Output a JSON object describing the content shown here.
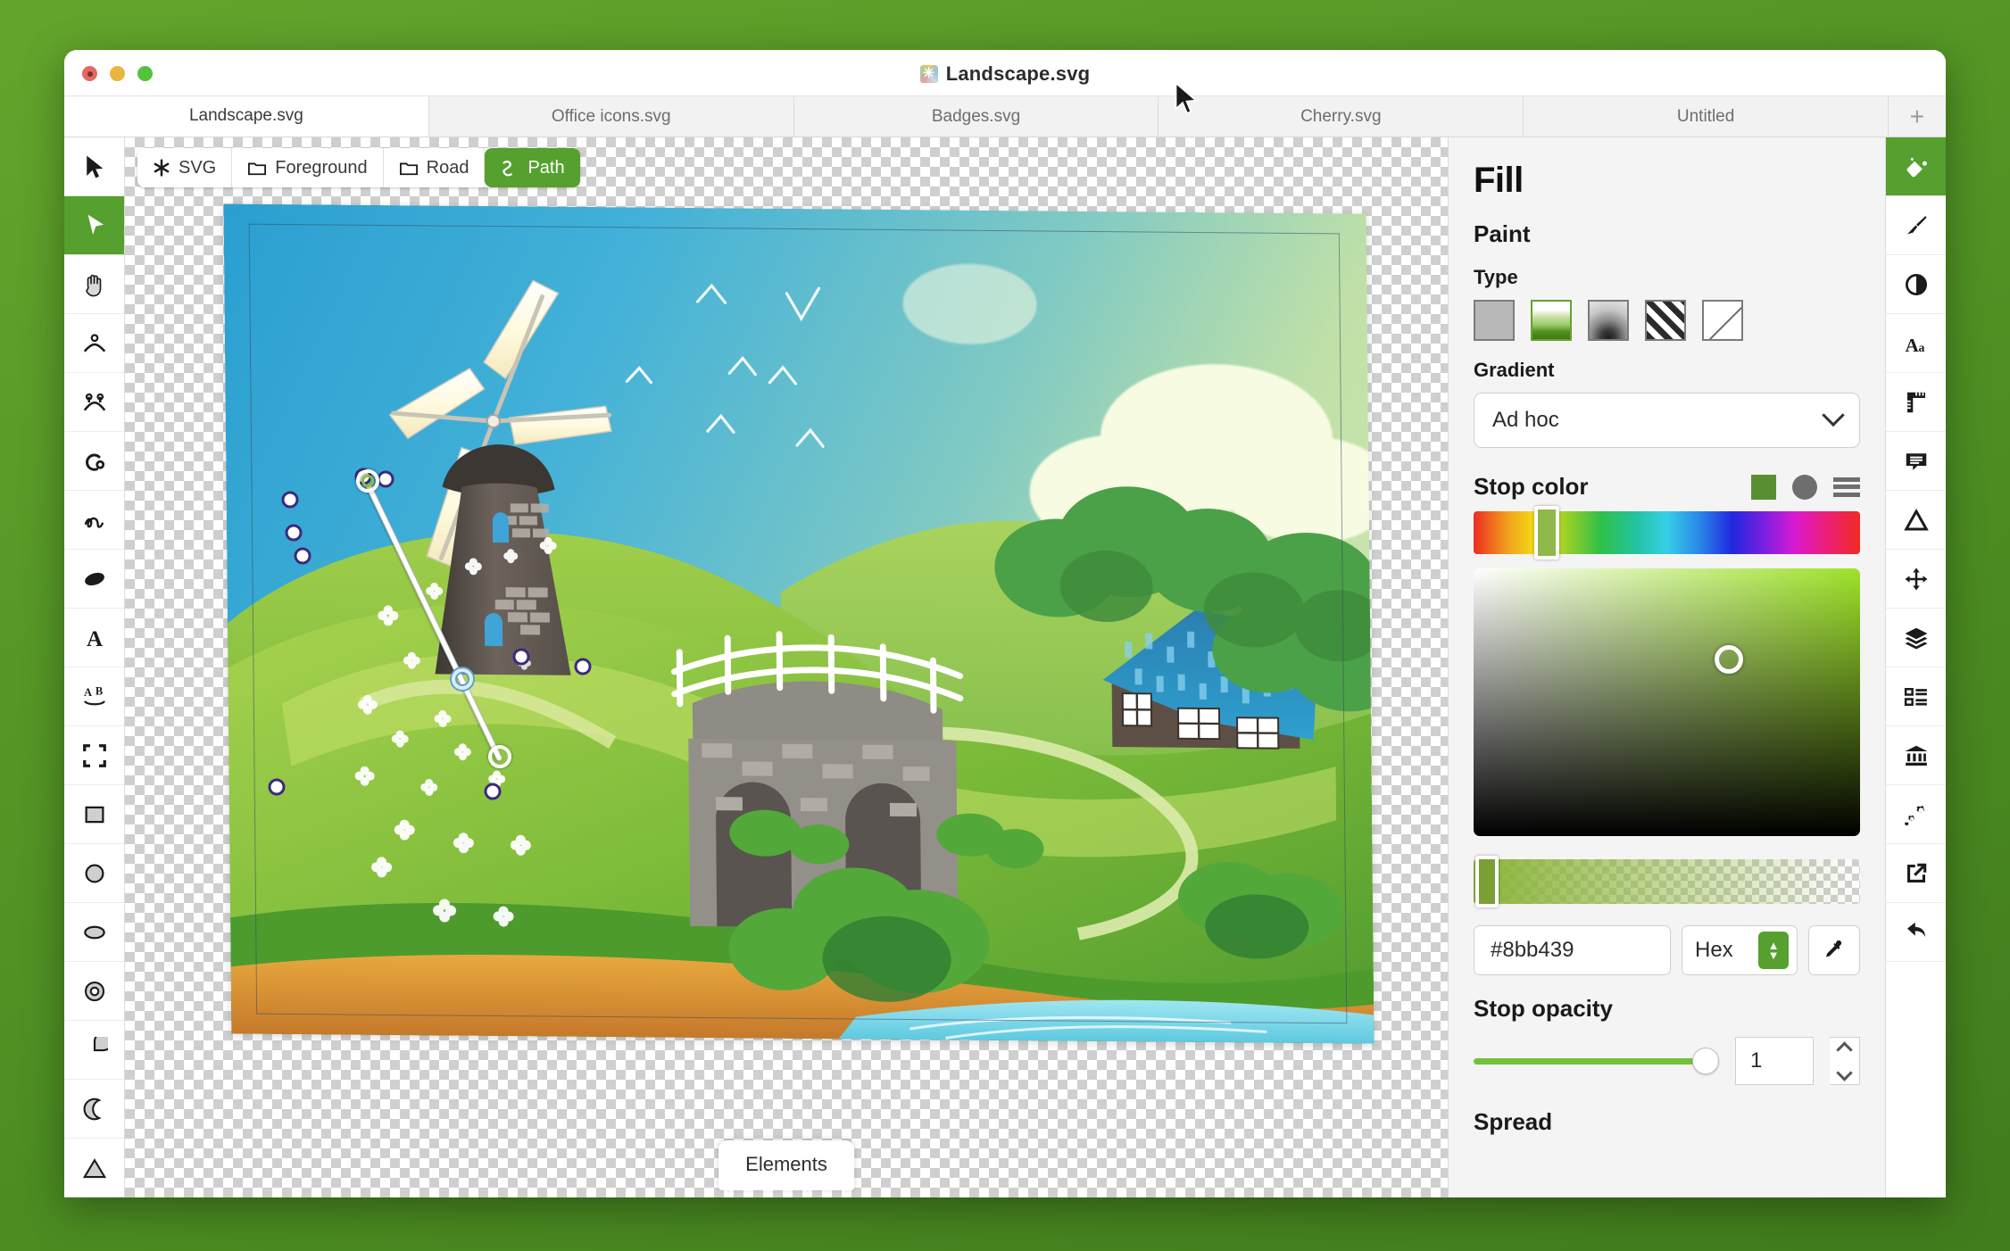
{
  "window": {
    "title": "Landscape.svg",
    "logo_icon": "svg-app-icon",
    "traffic_lights": [
      "close-button",
      "minimize-button",
      "zoom-button"
    ]
  },
  "tabs": {
    "items": [
      {
        "label": "Landscape.svg",
        "active": true
      },
      {
        "label": "Office icons.svg",
        "active": false
      },
      {
        "label": "Badges.svg",
        "active": false
      },
      {
        "label": "Cherry.svg",
        "active": false
      },
      {
        "label": "Untitled",
        "active": false
      }
    ],
    "add_label": "+"
  },
  "toolbar_left": {
    "items": [
      {
        "name": "select-tool",
        "icon": "arrow-pointer-icon",
        "active": false
      },
      {
        "name": "node-tool",
        "icon": "node-pointer-icon",
        "active": true
      },
      {
        "name": "pan-tool",
        "icon": "hand-icon",
        "active": false
      },
      {
        "name": "single-node-tool",
        "icon": "single-node-curve-icon",
        "active": false
      },
      {
        "name": "dual-node-tool",
        "icon": "dual-node-curve-icon",
        "active": false
      },
      {
        "name": "pen-tool",
        "icon": "pen-loop-icon",
        "active": false
      },
      {
        "name": "freehand-tool",
        "icon": "squiggle-icon",
        "active": false
      },
      {
        "name": "brush-tool",
        "icon": "blob-ellipse-icon",
        "active": false
      },
      {
        "name": "text-tool",
        "icon": "text-a-icon",
        "active": false
      },
      {
        "name": "text-on-path-tool",
        "icon": "text-ab-curve-icon",
        "active": false
      },
      {
        "name": "crop-tool",
        "icon": "crop-corners-icon",
        "active": false
      },
      {
        "name": "rectangle-tool",
        "icon": "square-icon",
        "active": false
      },
      {
        "name": "circle-tool",
        "icon": "circle-icon",
        "active": false
      },
      {
        "name": "ellipse-tool",
        "icon": "ellipse-icon",
        "active": false
      },
      {
        "name": "donut-tool",
        "icon": "donut-icon",
        "active": false
      },
      {
        "name": "pie-tool",
        "icon": "pie-icon",
        "active": false
      },
      {
        "name": "crescent-tool",
        "icon": "crescent-moon-icon",
        "active": false
      },
      {
        "name": "triangle-tool",
        "icon": "triangle-icon",
        "active": false
      }
    ]
  },
  "breadcrumb": {
    "items": [
      {
        "label": "SVG",
        "icon": "asterisk-icon",
        "active": false
      },
      {
        "label": "Foreground",
        "icon": "folder-icon",
        "active": false
      },
      {
        "label": "Road",
        "icon": "folder-icon",
        "active": false
      },
      {
        "label": "Path",
        "icon": "curve-path-icon",
        "active": true
      }
    ]
  },
  "canvas": {
    "elements_button": "Elements",
    "artwork_description": "Vector landscape illustration: windmill on a green hill, stone arch bridge with white railing, cottage with blue shingle roof, river, clouds, birds and white flowers",
    "selected_object": "Path",
    "path_nodes": 9,
    "gradient_handle": {
      "start_color": "#8bb439",
      "mid_handle": "midpoint-stop",
      "end_handle": "end-stop"
    }
  },
  "inspector": {
    "title": "Fill",
    "paint_heading": "Paint",
    "type_label": "Type",
    "types": [
      {
        "name": "flat-color",
        "selected": false
      },
      {
        "name": "linear-gradient",
        "selected": true
      },
      {
        "name": "radial-gradient",
        "selected": false
      },
      {
        "name": "pattern",
        "selected": false
      },
      {
        "name": "none",
        "selected": false
      }
    ],
    "gradient_label": "Gradient",
    "gradient_value": "Ad hoc",
    "stop_color_label": "Stop color",
    "stop_color_actions": [
      {
        "name": "swatch-picker",
        "icon": "green-square-icon",
        "color": "#5a8e33"
      },
      {
        "name": "wheel-picker",
        "icon": "gray-circle-icon",
        "color": "#6e6e6e"
      },
      {
        "name": "sliders-picker",
        "icon": "list-lines-icon"
      }
    ],
    "hex_value": "#8bb439",
    "color_mode": "Hex",
    "eyedropper": "eyedropper-icon",
    "stop_opacity_label": "Stop opacity",
    "stop_opacity_value": "1",
    "spread_label": "Spread",
    "accent_color": "#55a02e"
  },
  "rail_right": {
    "items": [
      {
        "name": "fill-panel",
        "icon": "paint-bucket-icon",
        "active": true
      },
      {
        "name": "stroke-panel",
        "icon": "paint-brush-icon",
        "active": false
      },
      {
        "name": "opacity-panel",
        "icon": "contrast-circle-icon",
        "active": false
      },
      {
        "name": "text-panel",
        "icon": "text-aa-icon",
        "active": false
      },
      {
        "name": "measure-panel",
        "icon": "ruler-icon",
        "active": false
      },
      {
        "name": "comments-panel",
        "icon": "speech-bubble-icon",
        "active": false
      },
      {
        "name": "shape-panel",
        "icon": "triangle-outline-icon",
        "active": false
      },
      {
        "name": "transform-panel",
        "icon": "move-arrows-icon",
        "active": false
      },
      {
        "name": "layers-panel",
        "icon": "layers-stack-icon",
        "active": false
      },
      {
        "name": "objects-panel",
        "icon": "list-items-icon",
        "active": false
      },
      {
        "name": "library-panel",
        "icon": "bank-columns-icon",
        "active": false
      },
      {
        "name": "effects-panel",
        "icon": "gears-icon",
        "active": false
      },
      {
        "name": "export-panel",
        "icon": "export-arrow-icon",
        "active": false
      },
      {
        "name": "history-panel",
        "icon": "undo-arrow-icon",
        "active": false
      }
    ]
  },
  "desktop": {
    "background_color": "#4e9a28"
  }
}
